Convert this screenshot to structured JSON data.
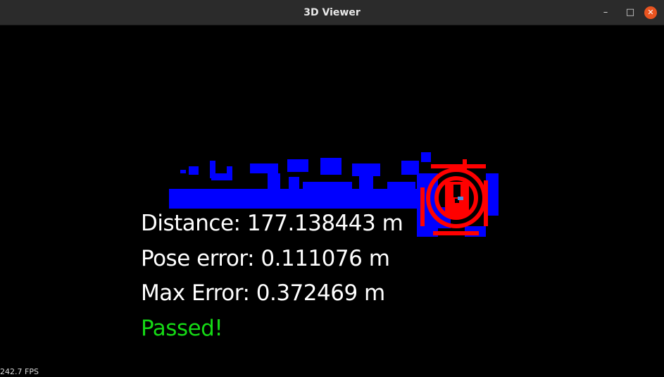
{
  "window": {
    "title": "3D Viewer",
    "minimize_icon": "–",
    "maximize_icon": "□",
    "close_icon": "✕"
  },
  "overlay": {
    "distance": "Distance: 177.138443 m",
    "pose_error": "Pose error: 0.111076 m",
    "max_error": "Max Error: 0.372469 m",
    "status": "Passed!"
  },
  "status_bar": {
    "fps": "242.7 FPS"
  },
  "colors": {
    "map_points": "#0000ff",
    "current_scan": "#ff0000",
    "status_pass": "#15d915",
    "text": "#ffffff",
    "background": "#000000",
    "close_button": "#e95420"
  }
}
